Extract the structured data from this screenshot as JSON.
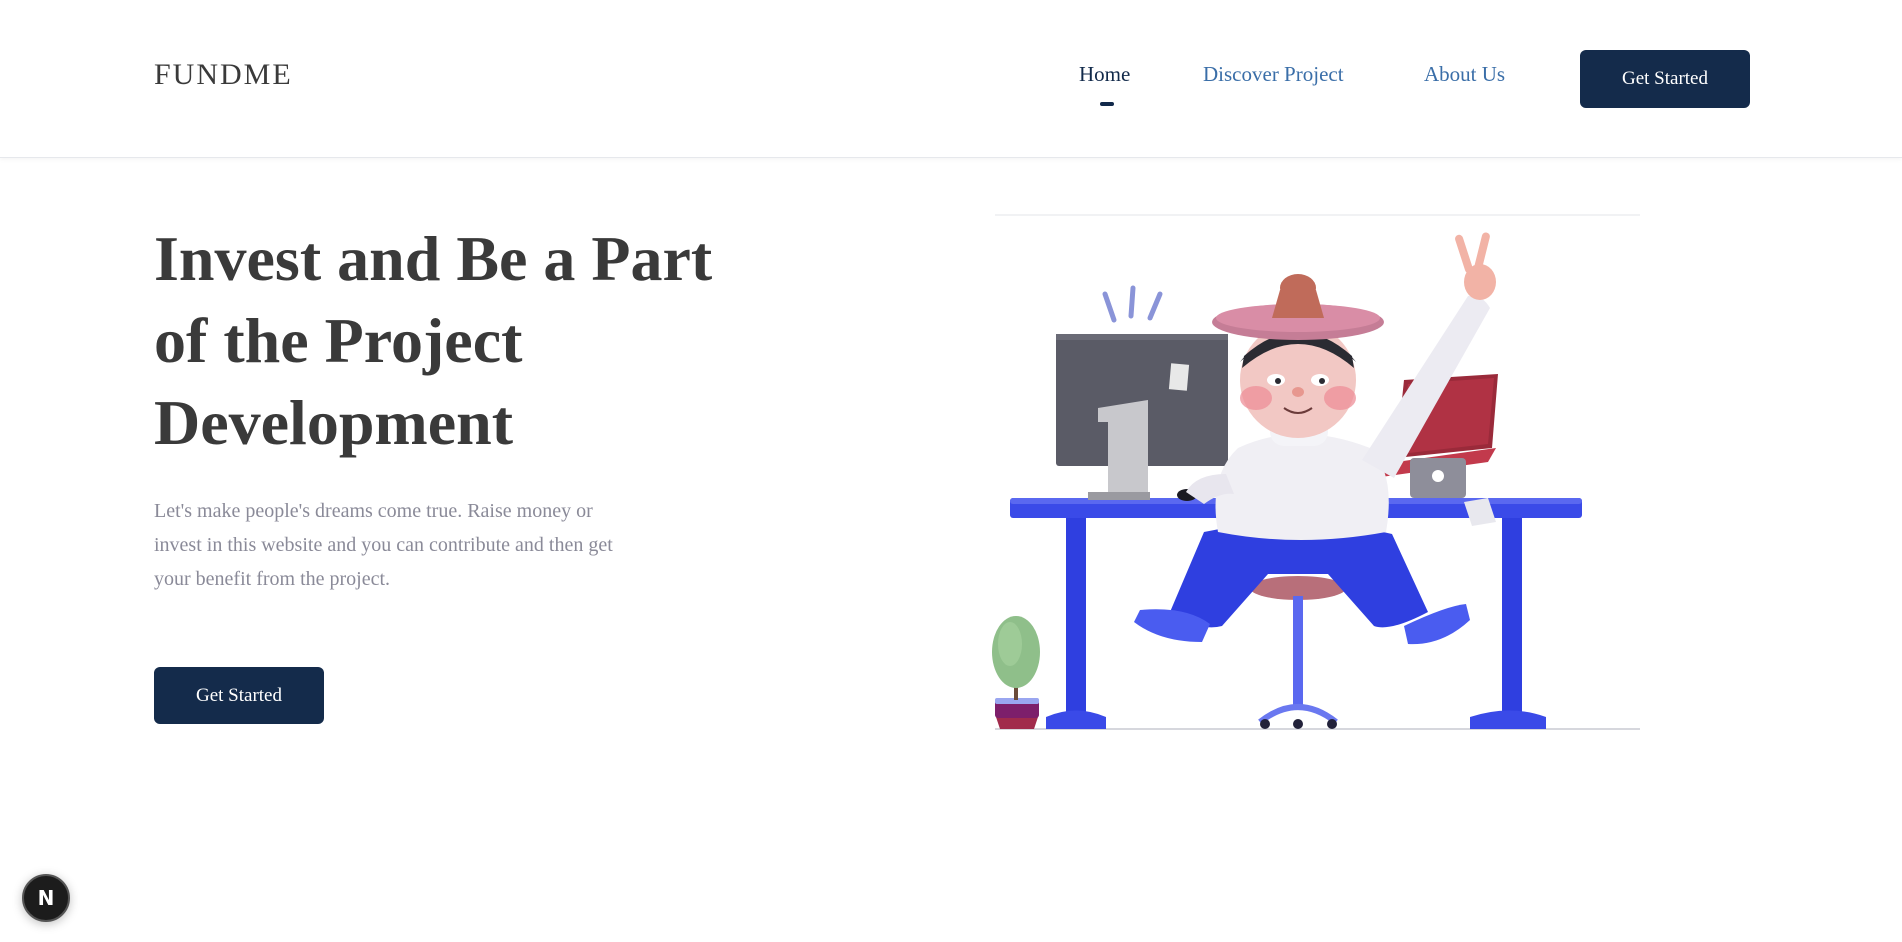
{
  "header": {
    "logo": "FUNDME",
    "nav": [
      {
        "label": "Home",
        "active": true
      },
      {
        "label": "Discover Project",
        "active": false
      },
      {
        "label": "About Us",
        "active": false
      }
    ],
    "cta_label": "Get Started"
  },
  "hero": {
    "title": "Invest and Be a Part of the Project Development",
    "description": "Let's make people's dreams come true. Raise money or invest in this website and you can contribute and then get your benefit from the project.",
    "cta_label": "Get Started",
    "illustration": "person-at-desk-illustration"
  },
  "badge": {
    "label": "N",
    "icon": "nextjs-icon"
  },
  "colors": {
    "primary": "#142b4b",
    "nav_link": "#3a6ea8",
    "heading": "#3a3a3a",
    "body_text": "#8a8a98",
    "desk": "#2f3fe0"
  }
}
